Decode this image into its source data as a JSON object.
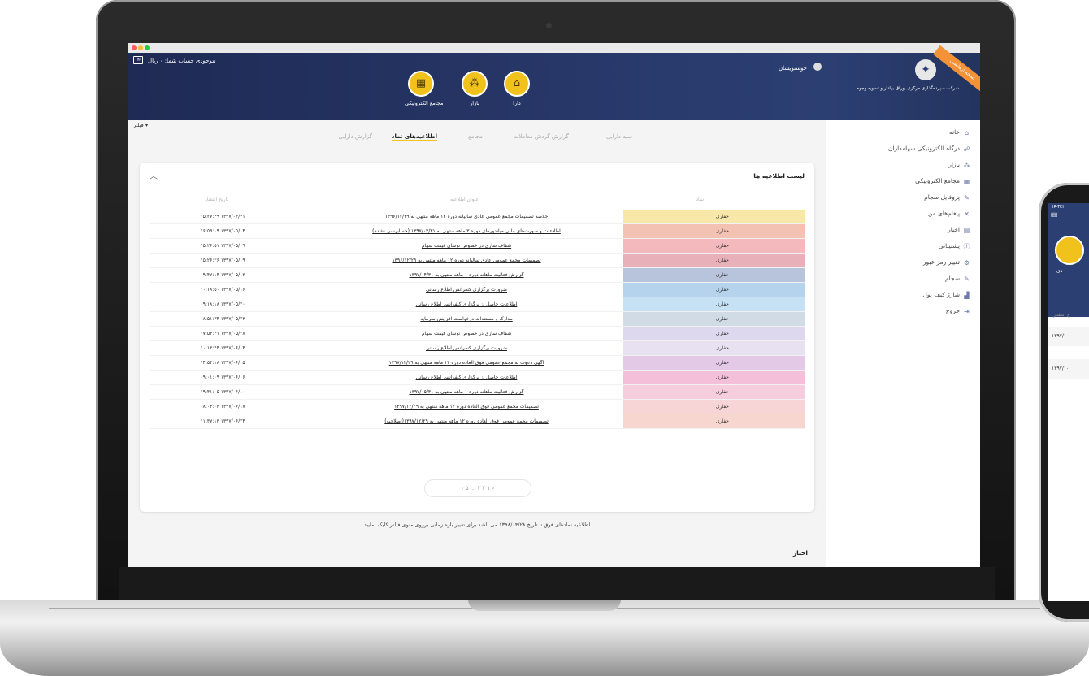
{
  "app": {
    "balance_label": "موجودی حساب شما: ۰ ریال",
    "user_name": "خوشنویسان",
    "company_name": "شرکت سپرده‌گذاری مرکزی اوراق بهادار و تسویه وجوه",
    "ribbon": "نسخه آزمایشی"
  },
  "nav": {
    "items": [
      {
        "label": "مجامع الکترونیکی"
      },
      {
        "label": "بازار"
      },
      {
        "label": "دارا"
      }
    ]
  },
  "sidebar": {
    "items": [
      {
        "label": "خانه"
      },
      {
        "label": "درگاه الکترونیکی سهامداران"
      },
      {
        "label": "بازار"
      },
      {
        "label": "مجامع الکترونیکی"
      },
      {
        "label": "پروفایل سجام"
      },
      {
        "label": "پیغام‌های من"
      },
      {
        "label": "اخبار"
      },
      {
        "label": "پشتیبانی"
      },
      {
        "label": "تغییر رمز عبور"
      },
      {
        "label": "سجام"
      },
      {
        "label": "شارژ کیف پول"
      },
      {
        "label": "خروج"
      }
    ]
  },
  "filter": "فیلتر",
  "tabs": [
    {
      "label": "سبد دارایی",
      "active": false
    },
    {
      "label": "گزارش گردش معاملات",
      "active": false
    },
    {
      "label": "مجامع",
      "active": false
    },
    {
      "label": "اطلاعیه‌های نماد",
      "active": true
    },
    {
      "label": "گزارش دارایی",
      "active": false
    }
  ],
  "card": {
    "title": "لیست اطلاعیه ها",
    "columns": {
      "symbol": "نماد",
      "title": "عنوان اطلاعیه",
      "date": "تاریخ انتشار"
    },
    "rows": [
      {
        "symbol": "حفاری",
        "title": "خلاصه تصمیمات مجمع عمومی عادی سالیانه دوره ۱۲ ماهه منتهی به ۱۳۹۶/۱۲/۲۹",
        "date": "۱۵:۲۷:۴۹ ۱۳۹۷/۰۴/۳۱",
        "color": "#f7e7a8"
      },
      {
        "symbol": "حفاری",
        "title": "اطلاعات و صورت‌های مالی میاندوره‌ای دوره ۳ ماهه منتهی به ۱۳۹۷/۰۳/۳۱ (حسابرسی نشده)",
        "date": "۱۶:۵۹:۰۹ ۱۳۹۷/۰۵/۰۴",
        "color": "#f4c2b3"
      },
      {
        "symbol": "حفاری",
        "title": "شفاف سازی در خصوص نوسان قیمت سهام",
        "date": "۱۵:۲۶:۵۱ ۱۳۹۷/۰۵/۰۹",
        "color": "#f3b9bd"
      },
      {
        "symbol": "حفاری",
        "title": "تصمیمات مجمع عمومی عادی سالیانه دوره ۱۲ ماهه منتهی به ۱۳۹۶/۱۲/۲۹",
        "date": "۱۵:۲۶:۲۶ ۱۳۹۷/۰۵/۰۹",
        "color": "#e8b0b8"
      },
      {
        "symbol": "حفاری",
        "title": "گزارش فعالیت ماهانه دوره ۱ ماهه منتهی به ۱۳۹۷/۰۴/۳۱",
        "date": "۰۹:۴۷:۱۴ ۱۳۹۷/۰۵/۱۳",
        "color": "#b7c4dc"
      },
      {
        "symbol": "حفاری",
        "title": "ضرورت برگزاری کنفرانس اطلاع رسانی",
        "date": "۱۰:۱۸:۵۰ ۱۳۹۷/۰۵/۱۶",
        "color": "#b6d3ee"
      },
      {
        "symbol": "حفاری",
        "title": "اطلاعات حاصل از برگزاری کنفرانس اطلاع رسانی",
        "date": "۰۹:۱۸:۱۸ ۱۳۹۷/۰۵/۲۰",
        "color": "#c5e1f3"
      },
      {
        "symbol": "حفاری",
        "title": "مدارک و مستندات درخواست افزایش سرمایه",
        "date": "۰۸:۵۱:۳۴ ۱۳۹۷/۰۵/۲۳",
        "color": "#d1dbe5"
      },
      {
        "symbol": "حفاری",
        "title": "شفاف سازی در خصوص نوسان قیمت سهام",
        "date": "۱۷:۵۴:۴۱ ۱۳۹۷/۰۵/۲۸",
        "color": "#ded8ee"
      },
      {
        "symbol": "حفاری",
        "title": "ضرورت برگزاری کنفرانس اطلاع رسانی",
        "date": "۱۰:۱۳:۴۴ ۱۳۹۷/۰۶/۰۴",
        "color": "#e7e1f1"
      },
      {
        "symbol": "حفاری",
        "title": "آگهی دعوت به مجمع عمومی فوق العاده دوره ۱۲ ماهه منتهی به ۱۳۹۷/۱۲/۲۹",
        "date": "۱۴:۵۴:۱۸ ۱۳۹۷/۰۶/۰۵",
        "color": "#e3c9e6"
      },
      {
        "symbol": "حفاری",
        "title": "اطلاعات حاصل از برگزاری کنفرانس اطلاع رسانی",
        "date": "۰۹:۰۱:۰۹ ۱۳۹۷/۰۶/۰۶",
        "color": "#f4c0d9"
      },
      {
        "symbol": "حفاری",
        "title": "گزارش فعالیت ماهانه دوره ۱ ماهه منتهی به ۱۳۹۷/۰۵/۳۱",
        "date": "۱۹:۴۱:۰۵ ۱۳۹۷/۰۶/۱۰",
        "color": "#f6cddd"
      },
      {
        "symbol": "حفاری",
        "title": "تصمیمات مجمع عمومی فوق العاده دوره ۱۲ ماهه منتهی به ۱۳۹۷/۱۲/۲۹",
        "date": "۰۸:۰۴:۰۴ ۱۳۹۷/۰۶/۱۷",
        "color": "#f7d5d6"
      },
      {
        "symbol": "حفاری",
        "title": "تصمیمات مجمع عمومی فوق العاده دوره ۱۲ ماهه منتهی به ۱۳۹۷/۱۲/۲۹(اصلاحیه)",
        "date": "۱۱:۳۷:۱۳ ۱۳۹۷/۰۶/۲۴",
        "color": "#f6d6cf"
      }
    ],
    "pager": "۵ ... ۳ ۲ ۱",
    "pager_current": "۱"
  },
  "footnote": "اطلاعیه نمادهای فوق تا تاریخ ۱۳۹۸/۰۴/۲۸ می باشد برای تغییر بازه زمانی برروی منوی فیلتر کلیک نمایید",
  "news_heading": "اخبار",
  "phone": {
    "carrier": "IR-TCI",
    "label": "دی",
    "column": "ع انتشار",
    "rows": [
      "۱۳۹۷/۱۰",
      "۱۳۹۷/۱۰"
    ]
  }
}
